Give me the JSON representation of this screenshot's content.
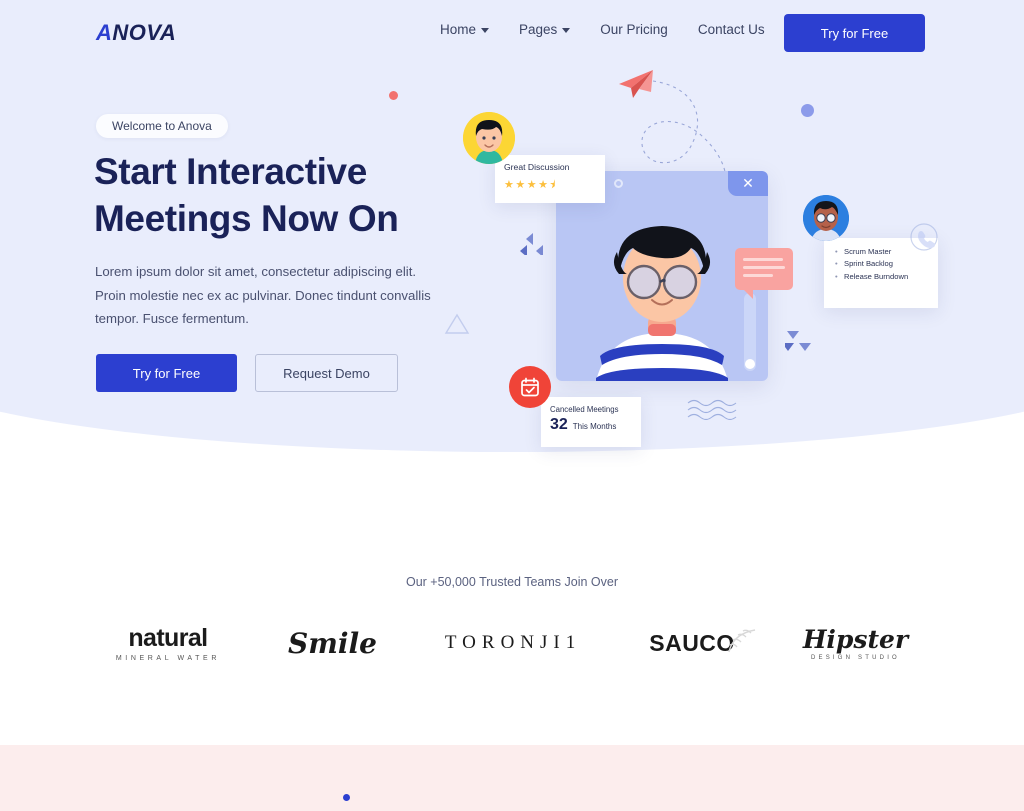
{
  "header": {
    "logo_text": "ANOVA",
    "logo_accent": "A",
    "logo_rest": "NOVA",
    "nav": [
      {
        "label": "Home",
        "has_dropdown": true
      },
      {
        "label": "Pages",
        "has_dropdown": true
      },
      {
        "label": "Our Pricing",
        "has_dropdown": false
      },
      {
        "label": "Contact Us",
        "has_dropdown": false
      }
    ],
    "cta_label": "Try for Free"
  },
  "hero": {
    "badge": "Welcome to Anova",
    "title": "Start Interactive Meetings Now On",
    "paragraph": "Lorem ipsum dolor sit amet, consectetur adipiscing elit. Proin molestie nec ex ac pulvinar. Donec tindunt convallis tempor. Fusce fermentum.",
    "primary_button": "Try for Free",
    "secondary_button": "Request Demo"
  },
  "illustration": {
    "discussion_card": {
      "title": "Great Discussion",
      "stars": "★★★★⯨",
      "rating": 4.5
    },
    "list_card": {
      "items": [
        "Scrum Master",
        "Sprint Backlog",
        "Release Burndown"
      ]
    },
    "cancelled_card": {
      "title": "Cancelled Meetings",
      "number": "32",
      "period": "This Months"
    },
    "video_window": {
      "close_label": "✕"
    }
  },
  "trusted": {
    "label": "Our +50,000 Trusted Teams Join Over",
    "brands": [
      {
        "name": "natural",
        "sub": "MINERAL WATER"
      },
      {
        "name": "Smile",
        "sub": ""
      },
      {
        "name": "TORONJI1",
        "sub": ""
      },
      {
        "name": "SAUCO",
        "sub": ""
      },
      {
        "name": "Hipster",
        "sub": "DESIGN STUDIO"
      }
    ]
  },
  "colors": {
    "hero_bg": "#e9edfc",
    "brand_blue": "#2c3fd0",
    "heading_navy": "#1a2258",
    "accent_red": "#f04438",
    "accent_pink": "#f9a3a0",
    "accent_yellow": "#fcd634",
    "pink_section": "#fceded"
  }
}
